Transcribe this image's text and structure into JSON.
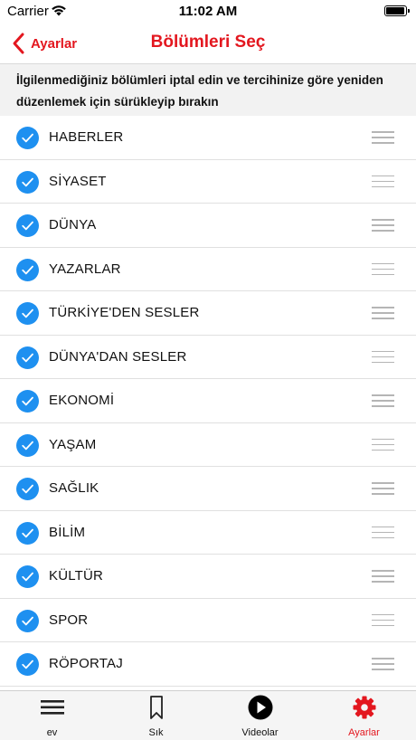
{
  "status_bar": {
    "carrier": "Carrier",
    "time": "11:02 AM",
    "battery_level": 0.95
  },
  "nav": {
    "back_label": "Ayarlar",
    "title": "Bölümleri Seç"
  },
  "instructions": "İlgilenmediğiniz bölümleri iptal edin ve tercihinize göre yeniden düzenlemek için sürükleyip bırakın",
  "sections": [
    {
      "label": "HABERLER",
      "checked": true
    },
    {
      "label": "SİYASET",
      "checked": true
    },
    {
      "label": "DÜNYA",
      "checked": true
    },
    {
      "label": "YAZARLAR",
      "checked": true
    },
    {
      "label": "TÜRKİYE'DEN SESLER",
      "checked": true
    },
    {
      "label": "DÜNYA'DAN SESLER",
      "checked": true
    },
    {
      "label": "EKONOMİ",
      "checked": true
    },
    {
      "label": "YAŞAM",
      "checked": true
    },
    {
      "label": "SAĞLIK",
      "checked": true
    },
    {
      "label": "BİLİM",
      "checked": true
    },
    {
      "label": "KÜLTÜR",
      "checked": true
    },
    {
      "label": "SPOR",
      "checked": true
    },
    {
      "label": "RÖPORTAJ",
      "checked": true
    }
  ],
  "tabs": [
    {
      "label": "ev",
      "icon": "list-icon",
      "active": false
    },
    {
      "label": "Sık",
      "icon": "bookmark-icon",
      "active": false
    },
    {
      "label": "Videolar",
      "icon": "play-icon",
      "active": false
    },
    {
      "label": "Ayarlar",
      "icon": "gear-icon",
      "active": true
    }
  ],
  "colors": {
    "accent": "#e3171f",
    "check": "#1e90f0",
    "instructions_bg": "#f2f2f2"
  }
}
